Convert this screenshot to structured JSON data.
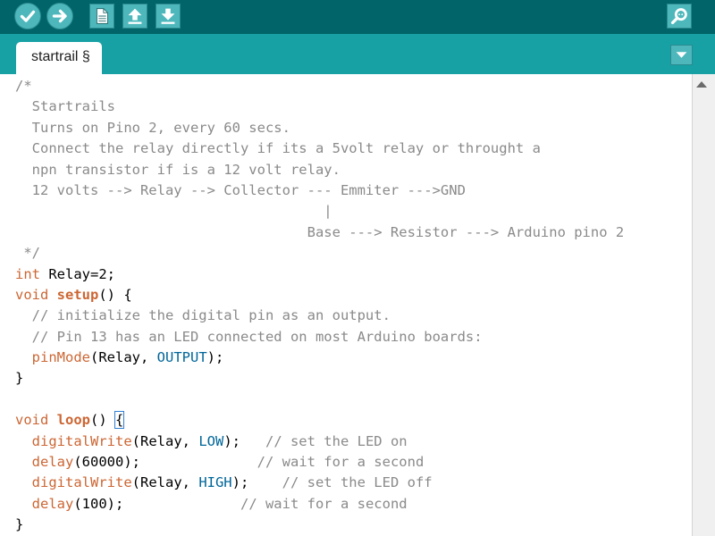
{
  "toolbar": {
    "buttons": [
      {
        "name": "verify",
        "icon": "checkmark-icon"
      },
      {
        "name": "upload",
        "icon": "arrow-right-icon"
      },
      {
        "name": "new",
        "icon": "new-document-icon"
      },
      {
        "name": "open",
        "icon": "arrow-up-icon"
      },
      {
        "name": "save",
        "icon": "arrow-down-icon"
      },
      {
        "name": "serial-monitor",
        "icon": "magnifier-icon"
      }
    ]
  },
  "tab": {
    "label": "startrail §"
  },
  "colors": {
    "toolbar": "#006468",
    "tabbar": "#17a1a5",
    "button": "#4db7bb",
    "keyword": "#cc6633",
    "constant": "#006699",
    "comment": "#8a8a8a"
  },
  "code": {
    "lines": [
      [
        {
          "t": "/*",
          "c": "cm"
        }
      ],
      [
        {
          "t": "  Startrails",
          "c": "cm"
        }
      ],
      [
        {
          "t": "  Turns on Pino 2, every 60 secs.",
          "c": "cm"
        }
      ],
      [
        {
          "t": "  Connect the relay directly if its a 5volt relay or throught a",
          "c": "cm"
        }
      ],
      [
        {
          "t": "  npn transistor if is a 12 volt relay.",
          "c": "cm"
        }
      ],
      [
        {
          "t": "  12 volts --> Relay --> Collector --- Emmiter --->GND",
          "c": "cm"
        }
      ],
      [
        {
          "t": "                                     |",
          "c": "cm"
        }
      ],
      [
        {
          "t": "                                   Base ---> Resistor ---> Arduino pino 2",
          "c": "cm"
        }
      ],
      [
        {
          "t": " */",
          "c": "cm"
        }
      ],
      [
        {
          "t": "int",
          "c": "kw"
        },
        {
          "t": " Relay=2;",
          "c": ""
        }
      ],
      [
        {
          "t": "void",
          "c": "kw"
        },
        {
          "t": " ",
          "c": ""
        },
        {
          "t": "setup",
          "c": "kwb"
        },
        {
          "t": "() {",
          "c": ""
        }
      ],
      [
        {
          "t": "  // initialize the digital pin as an output.",
          "c": "cm"
        }
      ],
      [
        {
          "t": "  // Pin 13 has an LED connected on most Arduino boards:",
          "c": "cm"
        }
      ],
      [
        {
          "t": "  ",
          "c": ""
        },
        {
          "t": "pinMode",
          "c": "kw"
        },
        {
          "t": "(Relay, ",
          "c": ""
        },
        {
          "t": "OUTPUT",
          "c": "cn"
        },
        {
          "t": ");",
          "c": ""
        }
      ],
      [
        {
          "t": "}",
          "c": ""
        }
      ],
      [
        {
          "t": "",
          "c": ""
        }
      ],
      [
        {
          "t": "void",
          "c": "kw"
        },
        {
          "t": " ",
          "c": ""
        },
        {
          "t": "loop",
          "c": "kwb"
        },
        {
          "t": "() ",
          "c": ""
        },
        {
          "t": "{",
          "c": "br"
        }
      ],
      [
        {
          "t": "  ",
          "c": ""
        },
        {
          "t": "digitalWrite",
          "c": "kw"
        },
        {
          "t": "(Relay, ",
          "c": ""
        },
        {
          "t": "LOW",
          "c": "cn"
        },
        {
          "t": ");   ",
          "c": ""
        },
        {
          "t": "// set the LED on",
          "c": "cm"
        }
      ],
      [
        {
          "t": "  ",
          "c": ""
        },
        {
          "t": "delay",
          "c": "kw"
        },
        {
          "t": "(60000);              ",
          "c": ""
        },
        {
          "t": "// wait for a second",
          "c": "cm"
        }
      ],
      [
        {
          "t": "  ",
          "c": ""
        },
        {
          "t": "digitalWrite",
          "c": "kw"
        },
        {
          "t": "(Relay, ",
          "c": ""
        },
        {
          "t": "HIGH",
          "c": "cn"
        },
        {
          "t": ");    ",
          "c": ""
        },
        {
          "t": "// set the LED off",
          "c": "cm"
        }
      ],
      [
        {
          "t": "  ",
          "c": ""
        },
        {
          "t": "delay",
          "c": "kw"
        },
        {
          "t": "(100);              ",
          "c": ""
        },
        {
          "t": "// wait for a second",
          "c": "cm"
        }
      ],
      [
        {
          "t": "}",
          "c": ""
        }
      ]
    ]
  }
}
